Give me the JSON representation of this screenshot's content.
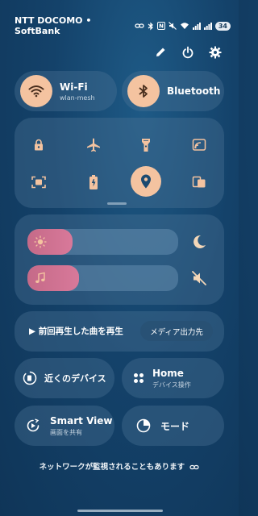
{
  "status_bar": {
    "carrier": "NTT DOCOMO • SoftBank",
    "battery": "34",
    "icons": [
      "link-icon",
      "bluetooth-icon",
      "nfc-icon",
      "mute-icon",
      "wifi-icon",
      "signal-icon",
      "signal-icon"
    ]
  },
  "top_actions": [
    "edit-icon",
    "power-icon",
    "settings-icon"
  ],
  "wifi_tile": {
    "title": "Wi-Fi",
    "subtitle": "wlan-mesh",
    "active": true
  },
  "bluetooth_tile": {
    "title": "Bluetooth",
    "active": true
  },
  "quick_toggles": [
    {
      "icon": "lock-rotation-icon",
      "active": false
    },
    {
      "icon": "airplane-icon",
      "active": false
    },
    {
      "icon": "flashlight-icon",
      "active": false
    },
    {
      "icon": "cast-icon",
      "active": false
    },
    {
      "icon": "screenshot-icon",
      "active": false
    },
    {
      "icon": "battery-saver-icon",
      "active": false
    },
    {
      "icon": "location-icon",
      "active": true
    },
    {
      "icon": "multi-screen-icon",
      "active": false
    }
  ],
  "sliders": {
    "brightness": {
      "level": 0.3,
      "icon": "sun-icon",
      "side_icon": "dark-mode-icon"
    },
    "volume": {
      "level": 0.34,
      "icon": "music-note-icon",
      "side_icon": "mute-icon"
    }
  },
  "media": {
    "play_label": "▶ 前回再生した曲を再生",
    "output_button": "メディア出力先"
  },
  "nearby_tile": {
    "title": "近くのデバイス"
  },
  "home_tile": {
    "title": "Home",
    "subtitle": "デバイス操作"
  },
  "smartview_tile": {
    "title": "Smart View",
    "subtitle": "画面を共有"
  },
  "mode_tile": {
    "title": "モード"
  },
  "footer": {
    "note": "ネットワークが監視されることもあります"
  },
  "colors": {
    "accent": "#f4c3a0",
    "icon": "#f4c3a0",
    "background": "#14426a"
  }
}
